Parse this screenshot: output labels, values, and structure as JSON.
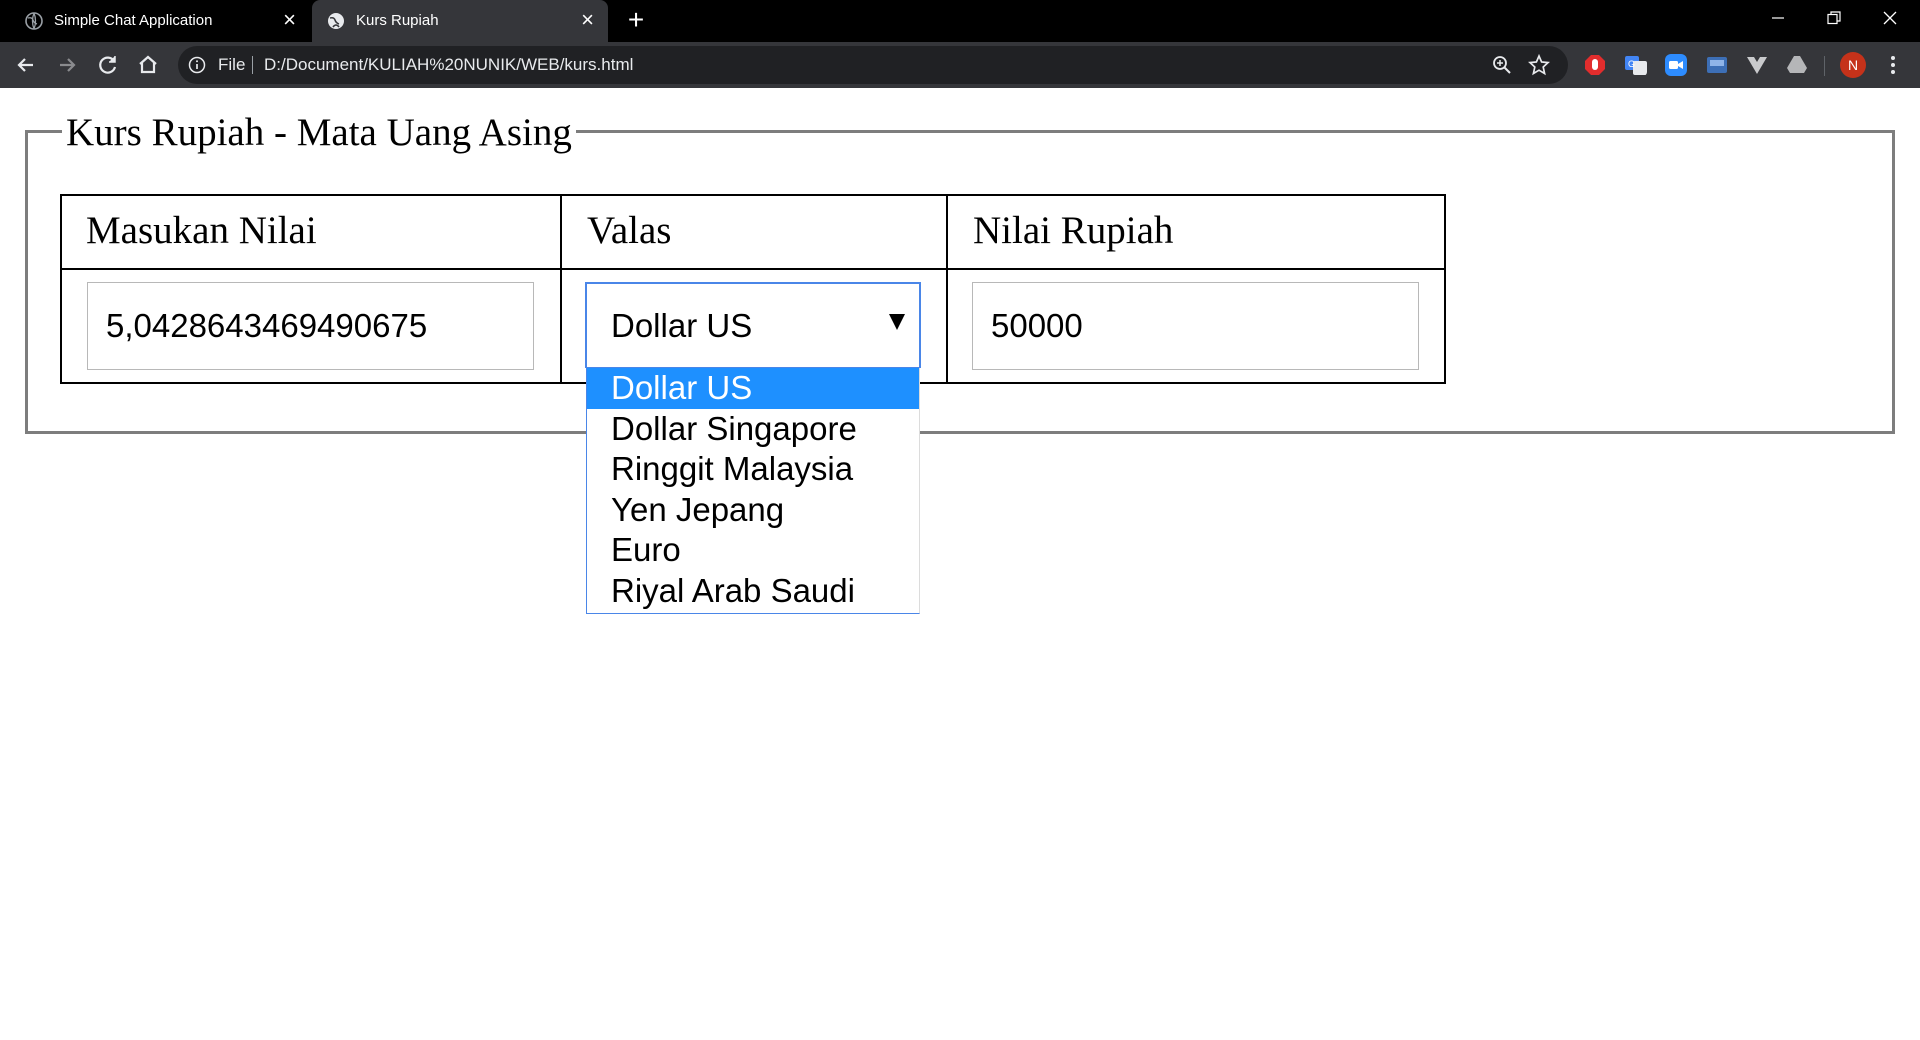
{
  "browser": {
    "tabs": [
      {
        "title": "Simple Chat Application",
        "active": false
      },
      {
        "title": "Kurs Rupiah",
        "active": true
      }
    ],
    "newtab_icon": "plus-icon",
    "window_controls": {
      "minimize": "–",
      "restore": "❐",
      "close": "✕"
    },
    "address": {
      "scheme_label": "File",
      "url": "D:/Document/KULIAH%20NUNIK/WEB/kurs.html"
    },
    "profile_initial": "N"
  },
  "page": {
    "legend": "Kurs Rupiah - Mata Uang Asing",
    "headers": [
      "Masukan Nilai",
      "Valas",
      "Nilai Rupiah"
    ],
    "input_value": "5,0428643469490675",
    "select": {
      "selected": "Dollar US",
      "options": [
        "Dollar US",
        "Dollar Singapore",
        "Ringgit Malaysia",
        "Yen Jepang",
        "Euro",
        "Riyal Arab Saudi"
      ],
      "highlighted_index": 0
    },
    "rupiah_value": "50000"
  },
  "colors": {
    "tabbar_bg": "#000000",
    "toolbar_bg": "#35363a",
    "omnibox_bg": "#202124",
    "select_focus": "#4a86e8",
    "option_highlight": "#1e90ff",
    "avatar_bg": "#c5321a"
  }
}
